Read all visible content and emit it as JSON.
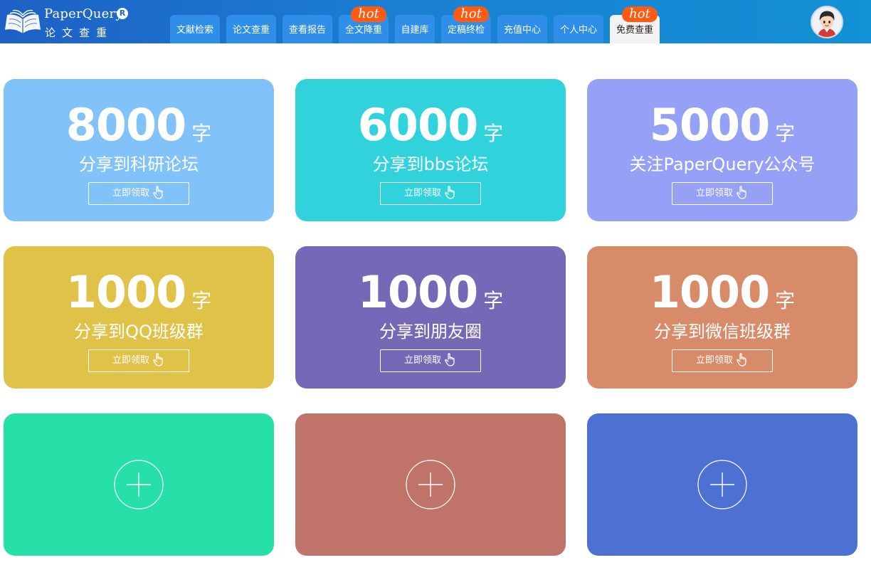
{
  "brand": {
    "name_en": "PaperQuery",
    "reg_mark": "R",
    "name_cn": "论文查重"
  },
  "nav": {
    "tabs": [
      {
        "label": "文献检索",
        "hot": false,
        "active": false
      },
      {
        "label": "论文查重",
        "hot": false,
        "active": false
      },
      {
        "label": "查看报告",
        "hot": false,
        "active": false
      },
      {
        "label": "全文降重",
        "hot": true,
        "active": false
      },
      {
        "label": "自建库",
        "hot": false,
        "active": false
      },
      {
        "label": "定稿终检",
        "hot": true,
        "active": false
      },
      {
        "label": "充值中心",
        "hot": false,
        "active": false
      },
      {
        "label": "个人中心",
        "hot": false,
        "active": false
      },
      {
        "label": "免费查重",
        "hot": true,
        "active": true
      }
    ],
    "hot_label": "hot"
  },
  "cards": [
    {
      "number": "8000",
      "unit": "字",
      "desc": "分享到科研论坛",
      "button": "立即领取",
      "color": "#81c2f8"
    },
    {
      "number": "6000",
      "unit": "字",
      "desc": "分享到bbs论坛",
      "button": "立即领取",
      "color": "#30d3dc"
    },
    {
      "number": "5000",
      "unit": "字",
      "desc": "关注PaperQuery公众号",
      "button": "立即领取",
      "color": "#94a1f7"
    },
    {
      "number": "1000",
      "unit": "字",
      "desc": "分享到QQ班级群",
      "button": "立即领取",
      "color": "#e0c248"
    },
    {
      "number": "1000",
      "unit": "字",
      "desc": "分享到朋友圈",
      "button": "立即领取",
      "color": "#7468b7"
    },
    {
      "number": "1000",
      "unit": "字",
      "desc": "分享到微信班级群",
      "button": "立即领取",
      "color": "#d88b69"
    }
  ],
  "add_cards": [
    {
      "color": "#27e0a7"
    },
    {
      "color": "#c07369"
    },
    {
      "color": "#4d71d2"
    }
  ],
  "colors": {
    "header_start": "#1e60c6",
    "header_end": "#1291d6",
    "tab_bg": "#2f8fe8",
    "tab_active_bg": "#f3f3f3",
    "hot_badge": "#ff5a12"
  }
}
